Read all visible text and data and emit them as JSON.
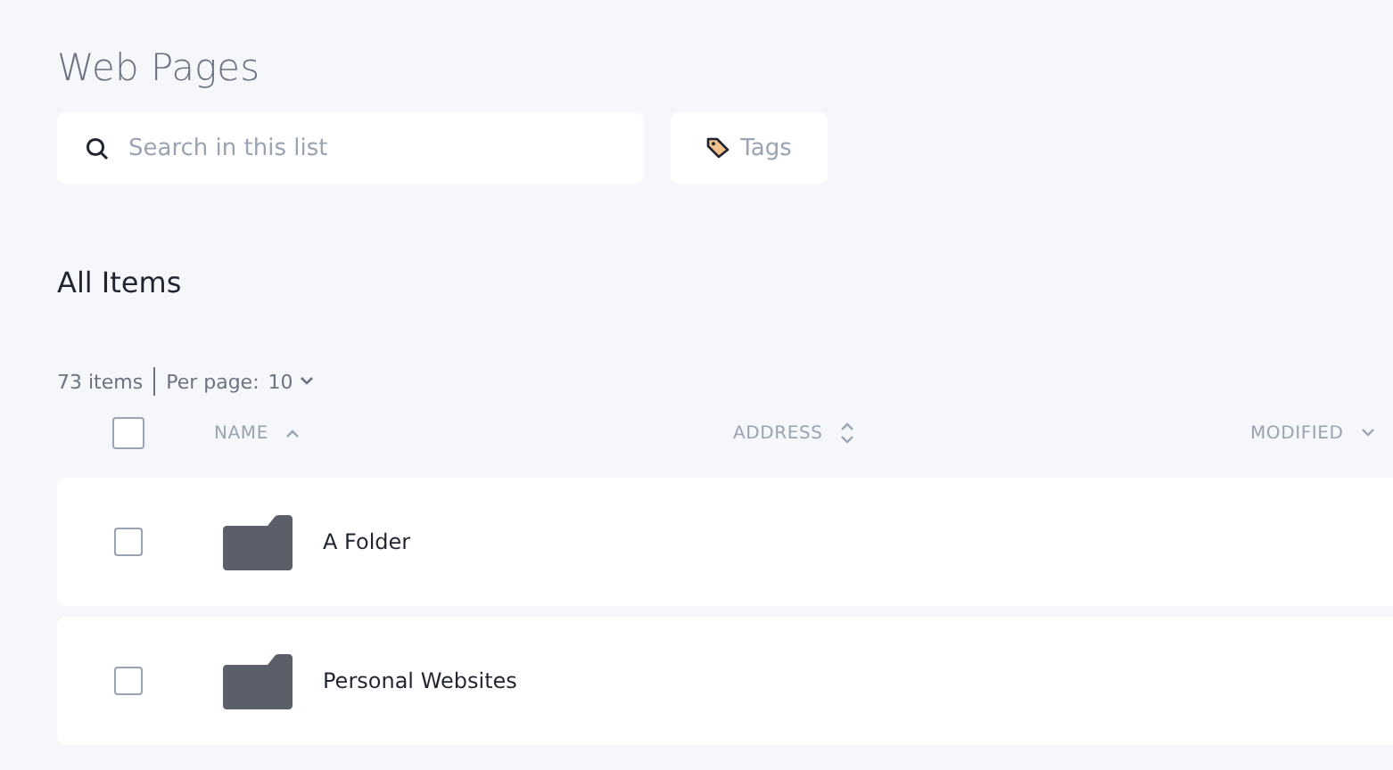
{
  "title": "Web Pages",
  "search": {
    "placeholder": "Search in this list"
  },
  "tags_button": {
    "label": "Tags"
  },
  "section_title": "All Items",
  "summary": {
    "count": "73 items",
    "per_page_label": "Per page:",
    "per_page_value": "10"
  },
  "table": {
    "select_all": {
      "checked": false
    },
    "columns": [
      {
        "label": "NAME",
        "sorted": true,
        "ascending": true
      },
      {
        "label": "ADDRESS",
        "sorted": false
      },
      {
        "label": "MODIFIED",
        "sorted": true,
        "ascending": false
      }
    ],
    "rows": [
      {
        "kind": "folder",
        "name": "A Folder",
        "checked": false
      },
      {
        "kind": "folder",
        "name": "Personal Websites",
        "checked": false
      }
    ]
  }
}
